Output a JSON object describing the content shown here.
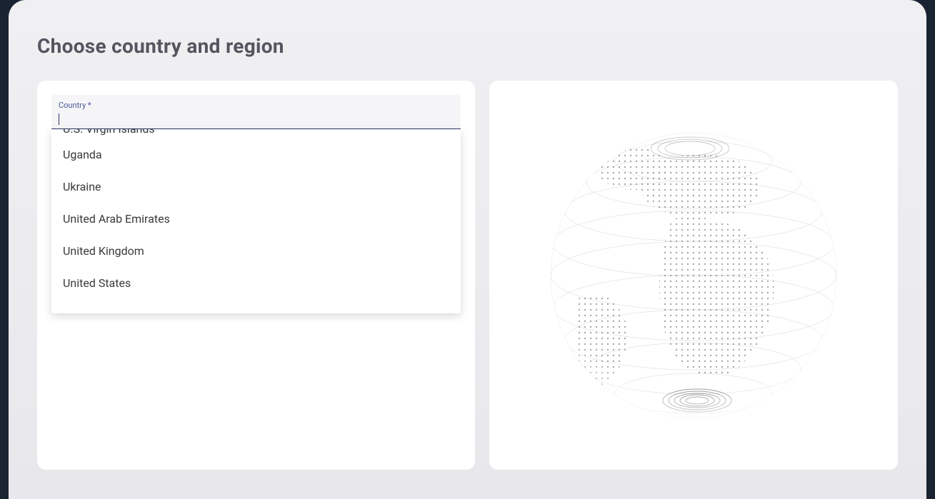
{
  "page": {
    "title": "Choose country and region"
  },
  "countryField": {
    "label": "Country *",
    "value": ""
  },
  "dropdown": {
    "partialTopItem": "U.S. Virgin Islands",
    "items": [
      "Uganda",
      "Ukraine",
      "United Arab Emirates",
      "United Kingdom",
      "United States"
    ]
  },
  "colors": {
    "pageBackground": "#1a2332",
    "panelBackground": "#ffffff",
    "containerBackground": "#f0f0f2",
    "titleColor": "#555560",
    "labelColor": "#4a5a9a",
    "inputUnderline": "#2a3568",
    "itemText": "#3a3a3a"
  }
}
